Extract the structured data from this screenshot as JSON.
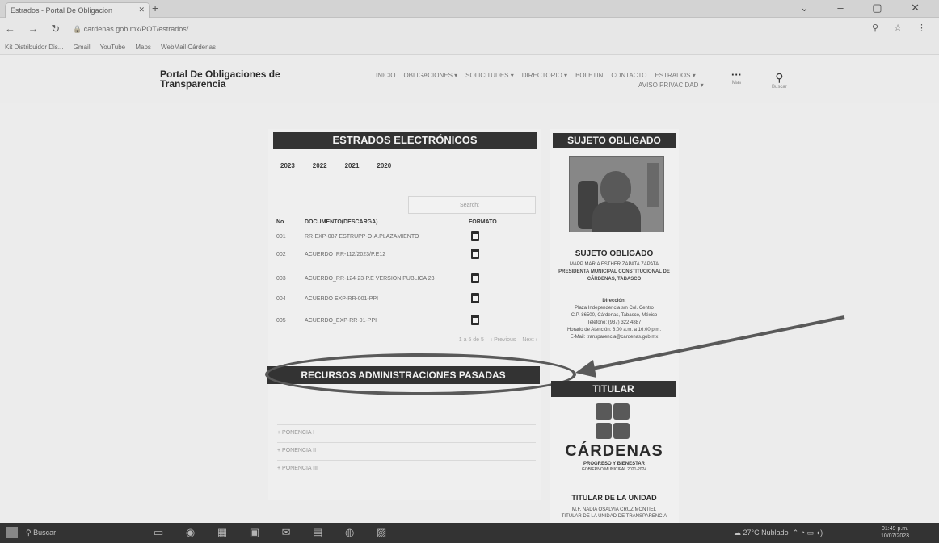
{
  "browser": {
    "tab_title": "Estrados - Portal De Obligacion",
    "url": "cardenas.gob.mx/POT/estrados/",
    "bookmarks": [
      "Kit Distribuidor Dis...",
      "Gmail",
      "YouTube",
      "Maps",
      "WebMail Cárdenas"
    ]
  },
  "site": {
    "brand": "Portal De Obligaciones de Transparencia",
    "nav": [
      "INICIO",
      "OBLIGACIONES ▾",
      "SOLICITUDES ▾",
      "DIRECTORIO ▾",
      "BOLETIN",
      "CONTACTO",
      "ESTRADOS ▾",
      "AVISO PRIVACIDAD ▾"
    ],
    "more_label": "Mas",
    "search_label": "Buscar"
  },
  "estrados": {
    "title": "ESTRADOS ELECTRÓNICOS",
    "years": [
      "2023",
      "2022",
      "2021",
      "2020"
    ],
    "search_placeholder": "Search:",
    "columns": [
      "No",
      "DOCUMENTO(DESCARGA)",
      "FORMATO"
    ],
    "rows": [
      {
        "no": "001",
        "doc": "RR-EXP-087 ESTRUPP-O-A.PLAZAMIENTO"
      },
      {
        "no": "002",
        "doc": "ACUERDO_RR-112/2023/P.E12"
      },
      {
        "no": "003",
        "doc": "ACUERDO_RR-124-23-P.E VERSION PUBLICA 23"
      },
      {
        "no": "004",
        "doc": "ACUERDO EXP-RR-001-PPI"
      },
      {
        "no": "005",
        "doc": "ACUERDO_EXP-RR-01-PPI"
      }
    ],
    "pager": [
      "1 a 5 de 5",
      "‹ Previous",
      "Next ›"
    ]
  },
  "recursos": {
    "title": "RECURSOS ADMINISTRACIONES PASADAS",
    "items": [
      "+ PONENCIA I",
      "+ PONENCIA II",
      "+ PONENCIA III"
    ]
  },
  "sujeto": {
    "title": "SUJETO OBLIGADO",
    "heading": "SUJETO OBLIGADO",
    "name": "MAPP MARÍA ESTHER ZAPATA ZAPATA",
    "position": "PRESIDENTA MUNICIPAL CONSTITUCIONAL DE CÁRDENAS, TABASCO",
    "dir_label": "Dirección:",
    "address": [
      "Plaza Independencia s/n Col. Centro",
      "C.P. 86500, Cárdenas, Tabasco, México",
      "Teléfono: (937) 322 4887",
      "Horario de Atención: 8:00 a.m. a 16:00 p.m.",
      "E-Mail: transparencia@cardenas.gob.mx"
    ]
  },
  "titular": {
    "title": "TITULAR",
    "logo_word": "CÁRDENAS",
    "logo_tagline": "PROGRESO Y BIENESTAR",
    "logo_sub": "GOBIERNO MUNICIPAL 2021-2024",
    "unit_title": "TITULAR DE LA UNIDAD",
    "unit_lines": [
      "M.F. NADIA OSALVIA CRUZ MONTIEL",
      "TITULAR DE LA UNIDAD DE TRANSPARENCIA"
    ]
  },
  "taskbar": {
    "search": "Buscar",
    "weather": "27°C Nublado",
    "time": "01:49 p.m.",
    "date": "10/07/2023"
  }
}
